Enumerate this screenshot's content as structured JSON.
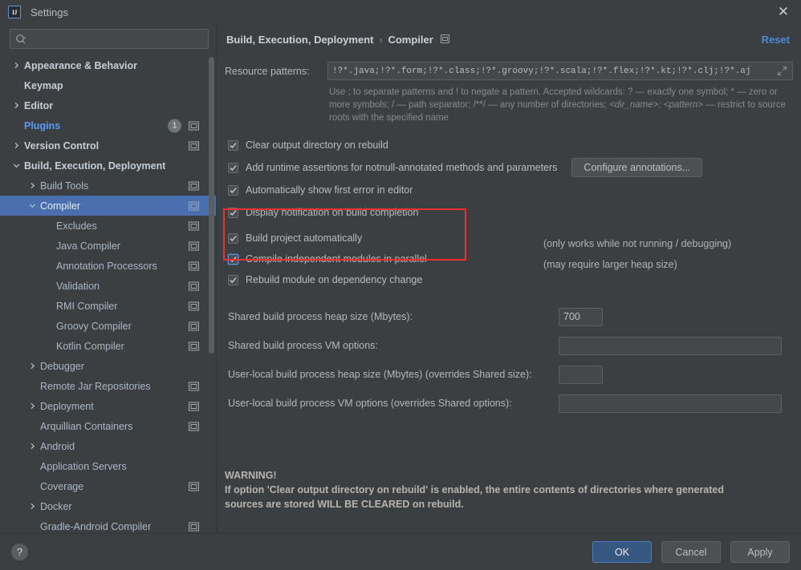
{
  "window": {
    "title": "Settings",
    "logo_text": "IJ",
    "close_icon": "close-icon"
  },
  "sidebar": {
    "search": {
      "placeholder": "",
      "value": "",
      "icon": "search-icon"
    },
    "items": [
      {
        "label": "Appearance & Behavior",
        "arrow": "right",
        "indent": 0,
        "bold": true,
        "cfg": false,
        "badge": ""
      },
      {
        "label": "Keymap",
        "arrow": "none",
        "indent": 0,
        "bold": true,
        "cfg": false,
        "badge": ""
      },
      {
        "label": "Editor",
        "arrow": "right",
        "indent": 0,
        "bold": true,
        "cfg": false,
        "badge": ""
      },
      {
        "label": "Plugins",
        "arrow": "none",
        "indent": 0,
        "bold": true,
        "cfg": true,
        "badge": "1"
      },
      {
        "label": "Version Control",
        "arrow": "right",
        "indent": 0,
        "bold": true,
        "cfg": true,
        "badge": ""
      },
      {
        "label": "Build, Execution, Deployment",
        "arrow": "down",
        "indent": 0,
        "bold": true,
        "cfg": false,
        "badge": ""
      },
      {
        "label": "Build Tools",
        "arrow": "right",
        "indent": 1,
        "bold": false,
        "cfg": true,
        "badge": ""
      },
      {
        "label": "Compiler",
        "arrow": "down",
        "indent": 1,
        "bold": false,
        "cfg": true,
        "badge": "",
        "selected": true
      },
      {
        "label": "Excludes",
        "arrow": "none",
        "indent": 2,
        "bold": false,
        "cfg": true,
        "badge": ""
      },
      {
        "label": "Java Compiler",
        "arrow": "none",
        "indent": 2,
        "bold": false,
        "cfg": true,
        "badge": ""
      },
      {
        "label": "Annotation Processors",
        "arrow": "none",
        "indent": 2,
        "bold": false,
        "cfg": true,
        "badge": ""
      },
      {
        "label": "Validation",
        "arrow": "none",
        "indent": 2,
        "bold": false,
        "cfg": true,
        "badge": ""
      },
      {
        "label": "RMI Compiler",
        "arrow": "none",
        "indent": 2,
        "bold": false,
        "cfg": true,
        "badge": ""
      },
      {
        "label": "Groovy Compiler",
        "arrow": "none",
        "indent": 2,
        "bold": false,
        "cfg": true,
        "badge": ""
      },
      {
        "label": "Kotlin Compiler",
        "arrow": "none",
        "indent": 2,
        "bold": false,
        "cfg": true,
        "badge": ""
      },
      {
        "label": "Debugger",
        "arrow": "right",
        "indent": 1,
        "bold": false,
        "cfg": false,
        "badge": ""
      },
      {
        "label": "Remote Jar Repositories",
        "arrow": "none",
        "indent": 1,
        "bold": false,
        "cfg": true,
        "badge": ""
      },
      {
        "label": "Deployment",
        "arrow": "right",
        "indent": 1,
        "bold": false,
        "cfg": true,
        "badge": ""
      },
      {
        "label": "Arquillian Containers",
        "arrow": "none",
        "indent": 1,
        "bold": false,
        "cfg": true,
        "badge": ""
      },
      {
        "label": "Android",
        "arrow": "right",
        "indent": 1,
        "bold": false,
        "cfg": false,
        "badge": ""
      },
      {
        "label": "Application Servers",
        "arrow": "none",
        "indent": 1,
        "bold": false,
        "cfg": false,
        "badge": ""
      },
      {
        "label": "Coverage",
        "arrow": "none",
        "indent": 1,
        "bold": false,
        "cfg": true,
        "badge": ""
      },
      {
        "label": "Docker",
        "arrow": "right",
        "indent": 1,
        "bold": false,
        "cfg": false,
        "badge": ""
      },
      {
        "label": "Gradle-Android Compiler",
        "arrow": "none",
        "indent": 1,
        "bold": false,
        "cfg": true,
        "badge": ""
      }
    ]
  },
  "header": {
    "crumb_root": "Build, Execution, Deployment",
    "crumb_sep": "›",
    "crumb_leaf": "Compiler",
    "crumb_icon": "settings-page-icon",
    "reset_label": "Reset"
  },
  "resource_patterns": {
    "label": "Resource patterns:",
    "value": "!?*.java;!?*.form;!?*.class;!?*.groovy;!?*.scala;!?*.flex;!?*.kt;!?*.clj;!?*.aj",
    "placeholder": "",
    "expand_icon": "expand-icon",
    "hint_part1": "Use ; to separate patterns and ! to negate a pattern. Accepted wildcards: ? — exactly one symbol; * — zero or more symbols; / — path separator; /**/ — any number of directories; ",
    "hint_italic": "<dir_name>: <pattern>",
    "hint_part2": " — restrict to source roots with the specified name"
  },
  "options": {
    "clear_output": {
      "label": "Clear output directory on rebuild",
      "checked": true
    },
    "add_assertions": {
      "label": "Add runtime assertions for notnull-annotated methods and parameters",
      "checked": true
    },
    "auto_error": {
      "label": "Automatically show first error in editor",
      "checked": true
    },
    "notify_build": {
      "label": "Display notification on build completion",
      "checked": true
    },
    "build_auto": {
      "label": "Build project automatically",
      "checked": true,
      "hint": "(only works while not running / debugging)"
    },
    "parallel": {
      "label": "Compile independent modules in parallel",
      "checked": true,
      "focused": true,
      "hint": "(may require larger heap size)"
    },
    "rebuild_dep": {
      "label": "Rebuild module on dependency change",
      "checked": true
    },
    "configure_annotations_button": "Configure annotations..."
  },
  "fields": {
    "shared_heap": {
      "label": "Shared build process heap size (Mbytes):",
      "value": "700",
      "placeholder": ""
    },
    "shared_vm": {
      "label": "Shared build process VM options:",
      "value": "",
      "placeholder": ""
    },
    "userlocal_heap": {
      "label": "User-local build process heap size (Mbytes) (overrides Shared size):",
      "value": "",
      "placeholder": ""
    },
    "userlocal_vm": {
      "label": "User-local build process VM options (overrides Shared options):",
      "value": "",
      "placeholder": ""
    }
  },
  "warning": {
    "title": "WARNING!",
    "line1": "If option 'Clear output directory on rebuild' is enabled, the entire contents of directories where generated",
    "line2": "sources are stored WILL BE CLEARED on rebuild."
  },
  "footer": {
    "help_label": "?",
    "ok_label": "OK",
    "cancel_label": "Cancel",
    "apply_label": "Apply"
  },
  "colors": {
    "accent_blue": "#4b6eaf",
    "link_blue": "#4a88d8",
    "highlight_red": "#f03030",
    "panel_bg": "#3c3f41",
    "field_bg": "#45484a"
  }
}
